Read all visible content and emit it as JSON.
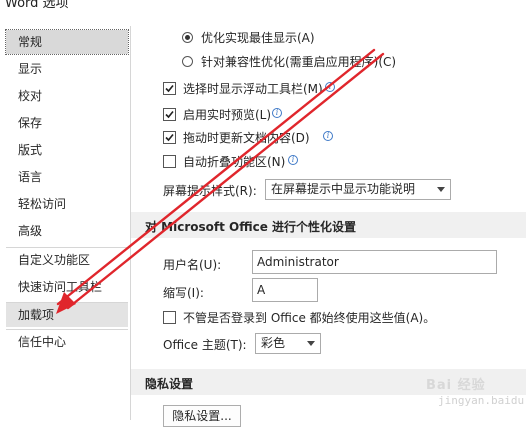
{
  "window": {
    "title": "Word 选项"
  },
  "sidebar": {
    "items": [
      {
        "label": "常规",
        "state": "selected"
      },
      {
        "label": "显示"
      },
      {
        "label": "校对"
      },
      {
        "label": "保存"
      },
      {
        "label": "版式"
      },
      {
        "label": "语言"
      },
      {
        "label": "轻松访问"
      },
      {
        "label": "高级"
      },
      {
        "label": "自定义功能区"
      },
      {
        "label": "快速访问工具栏"
      },
      {
        "label": "加载项",
        "state": "hovered"
      },
      {
        "label": "信任中心"
      }
    ]
  },
  "ui_options": {
    "radio_best_display": {
      "label": "优化实现最佳显示(A)",
      "checked": true
    },
    "radio_compatibility": {
      "label": "针对兼容性优化(需重启应用程序)(C)",
      "checked": false
    },
    "chk_mini_toolbar": {
      "label": "选择时显示浮动工具栏(M)",
      "checked": true
    },
    "chk_live_preview": {
      "label": "启用实时预览(L)",
      "checked": true
    },
    "chk_drag_update": {
      "label": "拖动时更新文档内容(D)",
      "checked": true
    },
    "chk_collapse_ribbon": {
      "label": "自动折叠功能区(N)",
      "checked": false
    },
    "screentip": {
      "label": "屏幕提示样式(R):",
      "value": "在屏幕提示中显示功能说明"
    }
  },
  "personalize": {
    "header": "对 Microsoft Office 进行个性化设置",
    "username_label": "用户名(U):",
    "username_value": "Administrator",
    "initials_label": "缩写(I):",
    "initials_value": "A",
    "always_use": {
      "label": "不管是否登录到 Office 都始终使用这些值(A)。",
      "checked": false
    },
    "theme_label": "Office 主题(T):",
    "theme_value": "彩色"
  },
  "privacy": {
    "header": "隐私设置",
    "button": "隐私设置..."
  },
  "annotation": {
    "color": "#e0262c"
  },
  "watermark": {
    "text": "Bai 经验",
    "sub": "jingyan.baidu.com"
  }
}
